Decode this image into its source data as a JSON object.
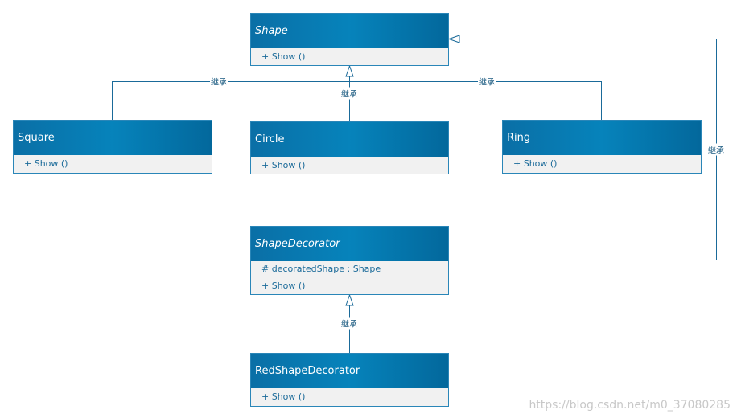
{
  "classes": {
    "shape": {
      "name": "Shape",
      "method": "+ Show ()"
    },
    "square": {
      "name": "Square",
      "method": "+ Show ()"
    },
    "circle": {
      "name": "Circle",
      "method": "+ Show ()"
    },
    "ring": {
      "name": "Ring",
      "method": "+ Show ()"
    },
    "decorator": {
      "name": "ShapeDecorator",
      "attribute": "# decoratedShape : Shape",
      "method": "+ Show ()"
    },
    "red": {
      "name": "RedShapeDecorator",
      "method": "+ Show ()"
    }
  },
  "relation_label": "継承",
  "watermark": "https://blog.csdn.net/m0_37080285",
  "colors": {
    "header": "#0683bb",
    "line": "#1a6a99"
  }
}
